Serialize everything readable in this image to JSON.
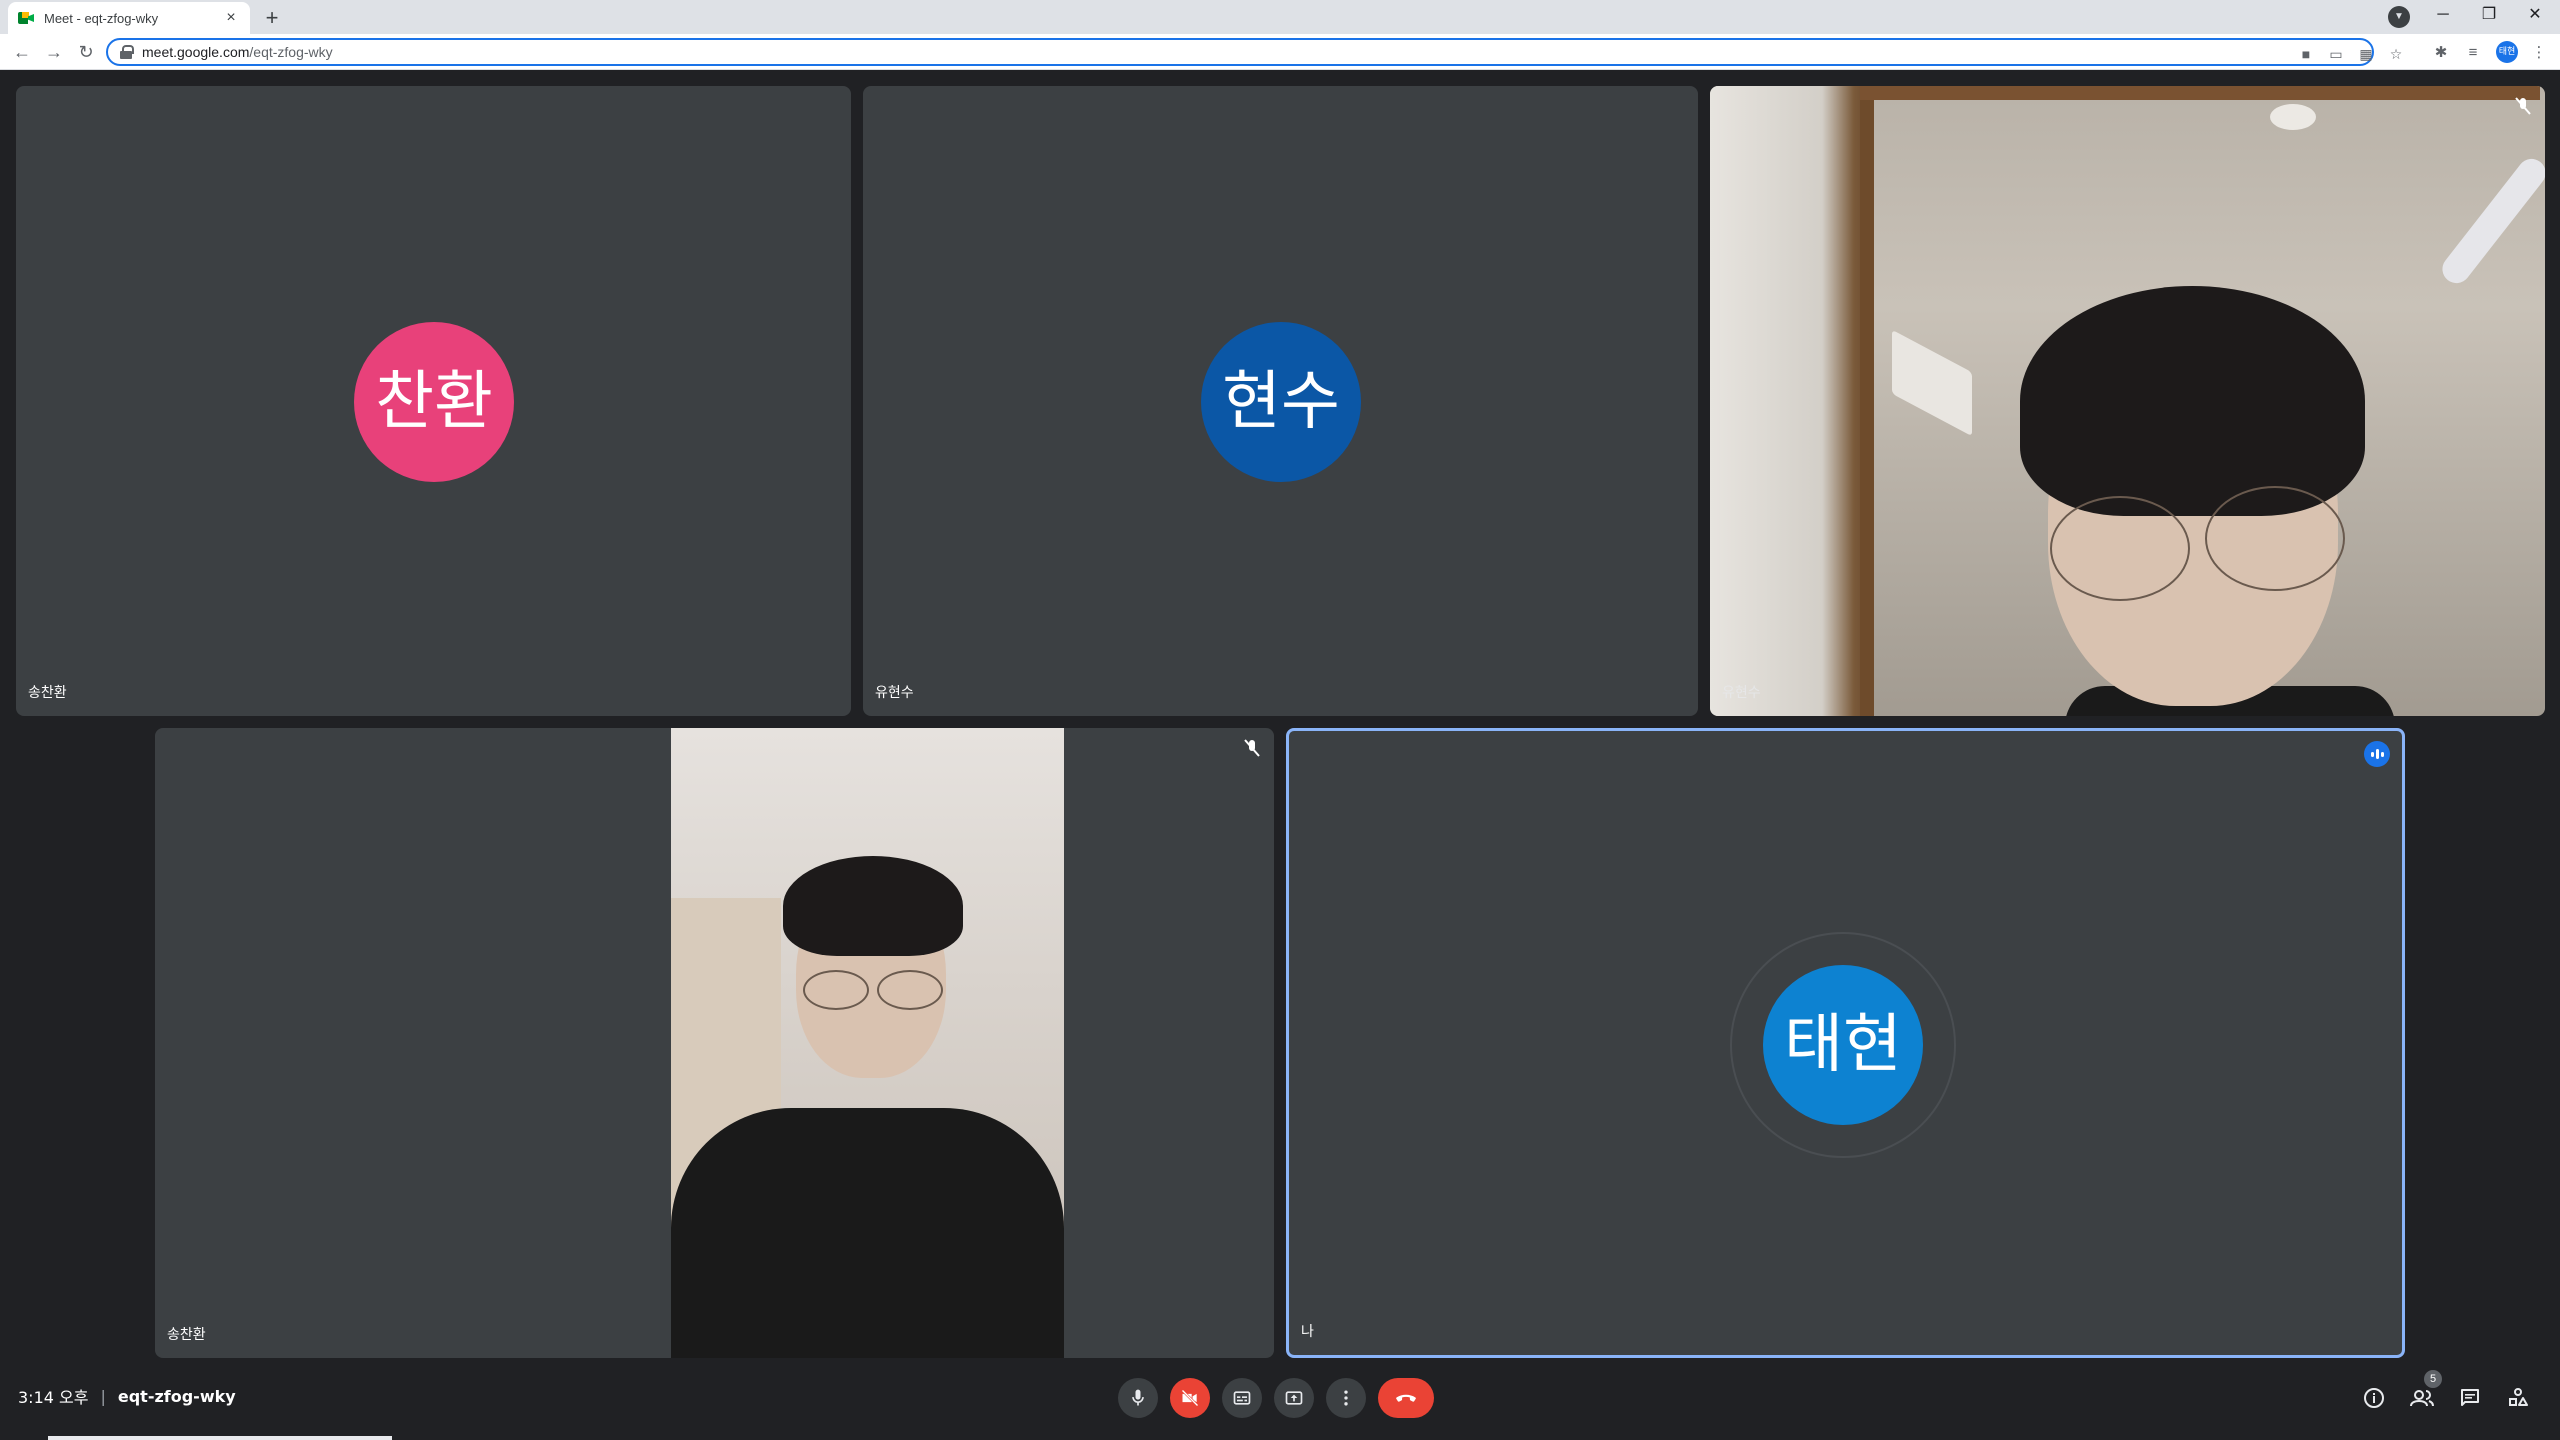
{
  "browser": {
    "tab_title": "Meet - eqt-zfog-wky",
    "tab_close": "×",
    "new_tab": "+",
    "url_host": "meet.google.com",
    "url_path": "/eqt-zfog-wky",
    "profile_initials": "태현",
    "window_minimize": "─",
    "window_restore": "❐",
    "window_close": "✕"
  },
  "tiles": [
    {
      "name": "송찬환",
      "avatar_text": "찬환",
      "avatar_color": "#e8417a",
      "video": false
    },
    {
      "name": "유현수",
      "avatar_text": "현수",
      "avatar_color": "#0b57a6",
      "video": false
    },
    {
      "name": "유현수",
      "video": true,
      "muted": true
    },
    {
      "name": "송찬환",
      "video": true,
      "muted": true
    },
    {
      "name": "나",
      "avatar_text": "태현",
      "avatar_color": "#0d82d1",
      "video": false,
      "speaking": true,
      "self": true
    }
  ],
  "meeting": {
    "time": "3:14 오후",
    "separator": "|",
    "code": "eqt-zfog-wky",
    "participant_count": "5"
  },
  "colors": {
    "background": "#202124",
    "tile_bg": "#3c4043",
    "accent": "#1a73e8",
    "danger": "#ea4335"
  },
  "icons": {
    "controls": [
      "mic-icon",
      "camera-off-icon",
      "captions-icon",
      "present-icon",
      "more-icon",
      "end-call-icon"
    ],
    "right": [
      "info-icon",
      "people-icon",
      "chat-icon",
      "activities-icon"
    ]
  }
}
